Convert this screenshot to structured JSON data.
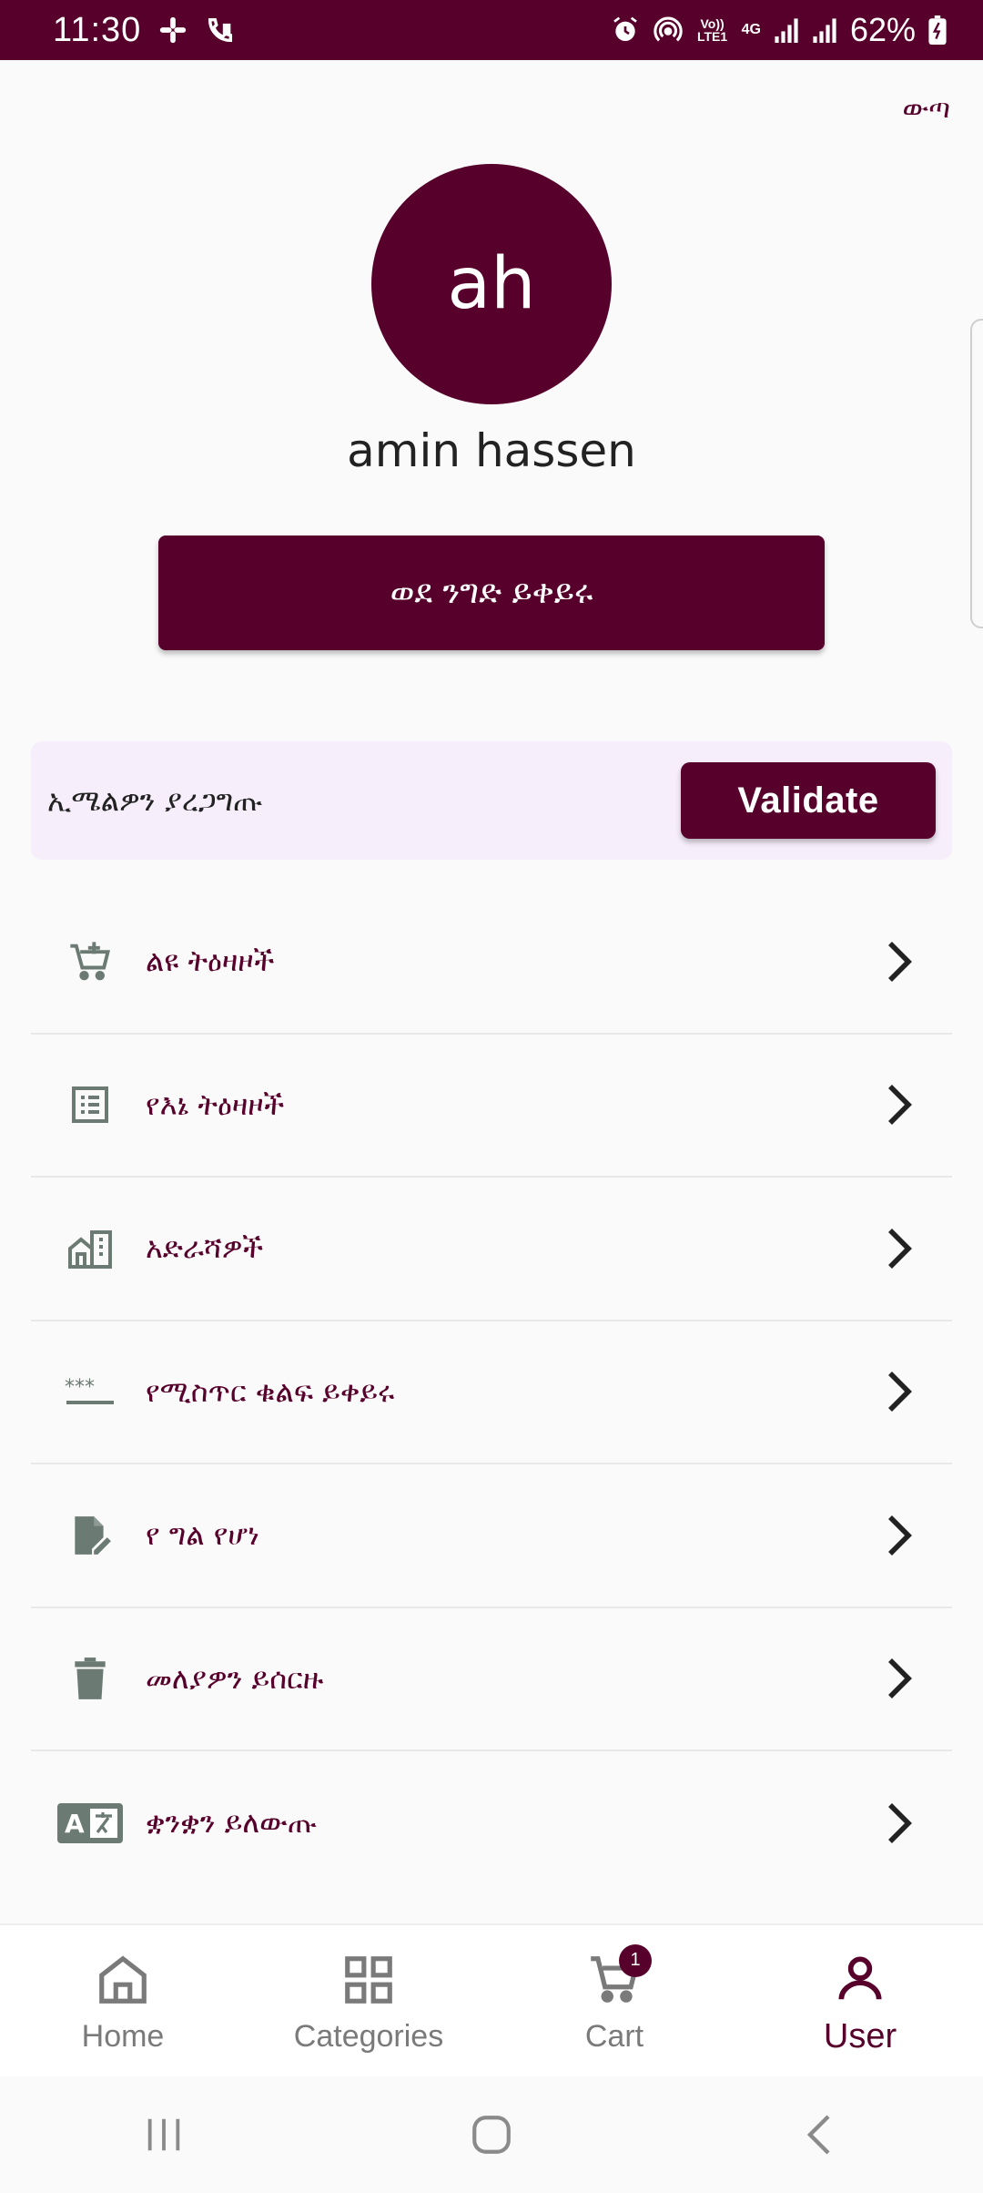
{
  "status_bar": {
    "time": "11:30",
    "battery_percent": "62%",
    "volte": "Vo)) LTE1",
    "network": "4G",
    "icons": [
      "slack-icon",
      "wifi-call-icon",
      "alarm-icon",
      "hotspot-icon",
      "volte-icon",
      "4g-icon",
      "signal-icon",
      "signal-icon",
      "battery-icon"
    ]
  },
  "header": {
    "logout_label": "ውጣ"
  },
  "profile": {
    "initials": "ah",
    "name": "amin hassen",
    "go_to_shop_label": "ወደ ንግድ ይቀይሩ"
  },
  "email_validation": {
    "message": "ኢሜልዎን ያረጋግጡ",
    "button_label": "Validate"
  },
  "menu": {
    "items": [
      {
        "label": "ልዩ ትዕዛዞች",
        "icon": "cart-icon"
      },
      {
        "label": "የእኔ ትዕዛዞች",
        "icon": "list-icon"
      },
      {
        "label": "አድራሻዎች",
        "icon": "buildings-icon"
      },
      {
        "label": "የሚስጥር ቁልፍ ይቀይሩ",
        "icon": "password-icon"
      },
      {
        "label": "የ ግል የሆነ",
        "icon": "edit-document-icon"
      },
      {
        "label": "መለያዎን ይሰርዙ",
        "icon": "trash-icon"
      },
      {
        "label": "ቋንቋን ይለውጡ",
        "icon": "translate-icon"
      }
    ]
  },
  "bottom_nav": {
    "items": [
      {
        "label": "Home",
        "icon": "home-icon",
        "active": false
      },
      {
        "label": "Categories",
        "icon": "grid-icon",
        "active": false
      },
      {
        "label": "Cart",
        "icon": "cart-icon",
        "active": false,
        "badge": "1"
      },
      {
        "label": "User",
        "icon": "user-icon",
        "active": true
      }
    ]
  },
  "colors": {
    "primary": "#57002b",
    "email_card_bg": "#f6eefb",
    "icon_gray": "#6b7a72",
    "background": "#fafafa"
  }
}
